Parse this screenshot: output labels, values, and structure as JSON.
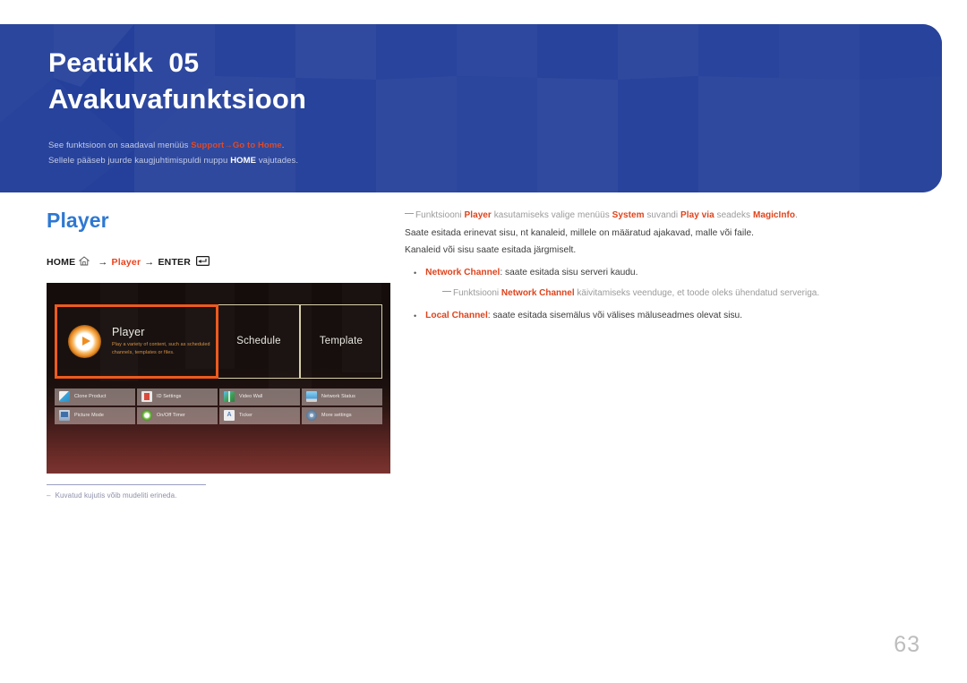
{
  "banner": {
    "chapter_label": "Peatükk  05",
    "chapter_title": "Avakuvafunktsioon",
    "note1_pre": "See funktsioon on saadaval menüüs ",
    "note1_menu": "Support",
    "note1_arrow": "→",
    "note1_target": "Go to Home",
    "note1_post": ".",
    "note2_pre": "Sellele pääseb juurde kaugjuhtimispuldi nuppu ",
    "note2_key": "HOME",
    "note2_post": " vajutades."
  },
  "left": {
    "section_title": "Player",
    "breadcrumb": {
      "home_label": "HOME",
      "home_icon": "home-icon",
      "arrow1": "→",
      "player_label": "Player",
      "arrow2": "→",
      "enter_label": "ENTER",
      "enter_icon": "enter-key-icon"
    },
    "screenshot": {
      "tiles": [
        {
          "label": "Player",
          "desc": "Play a variety of content, such as scheduled channels, templates or files.",
          "selected": true,
          "icon": "play-circle-icon"
        },
        {
          "label": "Schedule",
          "selected": false
        },
        {
          "label": "Template",
          "selected": false
        }
      ],
      "grid": [
        [
          {
            "label": "Clone Product",
            "icon": "clone-product-icon"
          },
          {
            "label": "ID Settings",
            "icon": "id-settings-icon"
          },
          {
            "label": "Video Wall",
            "icon": "video-wall-icon"
          },
          {
            "label": "Network Status",
            "icon": "network-status-icon"
          }
        ],
        [
          {
            "label": "Picture Mode",
            "icon": "picture-mode-icon"
          },
          {
            "label": "On/Off Timer",
            "icon": "on-off-timer-icon"
          },
          {
            "label": "Ticker",
            "icon": "ticker-icon"
          },
          {
            "label": "More settings",
            "icon": "more-settings-icon"
          }
        ]
      ]
    },
    "footnote": {
      "dash": "–",
      "text": "Kuvatud kujutis võib mudeliti erineda."
    }
  },
  "right": {
    "note": {
      "pre": "Funktsiooni ",
      "b1": "Player",
      "mid1": " kasutamiseks valige menüüs ",
      "b2": "System",
      "mid2": " suvandi ",
      "b3": "Play via",
      "mid3": " seadeks ",
      "b4": "MagicInfo",
      "post": "."
    },
    "para1": "Saate esitada erinevat sisu, nt kanaleid, millele on määratud ajakavad, malle või faile.",
    "para2": "Kanaleid või sisu saate esitada järgmiselt.",
    "bullets": [
      {
        "bold": "Network Channel",
        "rest": ": saate esitada sisu serveri kaudu.",
        "subnote": {
          "pre": "Funktsiooni ",
          "bold": "Network Channel",
          "post": " käivitamiseks veenduge, et toode oleks ühendatud serveriga."
        }
      },
      {
        "bold": "Local Channel",
        "rest": ": saate esitada sisemälus või välises mäluseadmes olevat sisu."
      }
    ],
    "bullet_marker": "•"
  },
  "page_number": "63",
  "colors": {
    "banner_bg": "#24409a",
    "accent_blue": "#2e78d2",
    "accent_red": "#e0431c",
    "selection_orange": "#ee5a1e"
  }
}
